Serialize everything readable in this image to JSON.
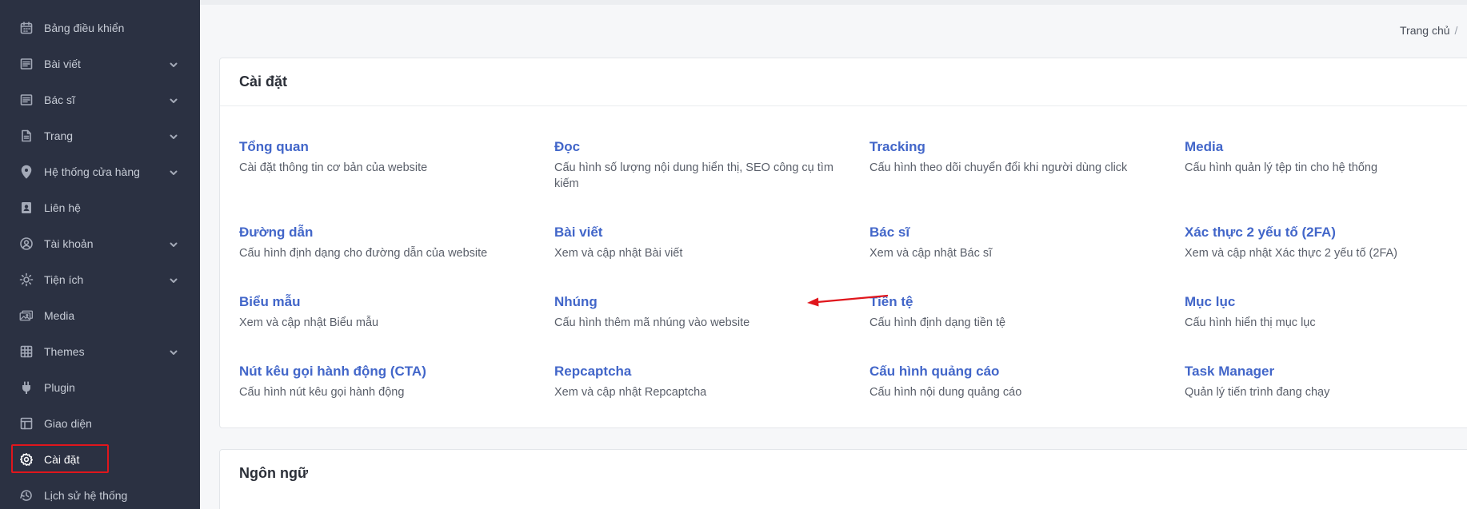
{
  "sidebar": {
    "items": [
      {
        "label": "Bảng điều khiển",
        "icon": "calendar-icon",
        "has_chevron": false
      },
      {
        "label": "Bài viết",
        "icon": "article-icon",
        "has_chevron": true
      },
      {
        "label": "Bác sĩ",
        "icon": "article-icon",
        "has_chevron": true
      },
      {
        "label": "Trang",
        "icon": "page-icon",
        "has_chevron": true
      },
      {
        "label": "Hệ thống cửa hàng",
        "icon": "map-pin-icon",
        "has_chevron": true
      },
      {
        "label": "Liên hệ",
        "icon": "contact-icon",
        "has_chevron": false
      },
      {
        "label": "Tài khoản",
        "icon": "user-circle-icon",
        "has_chevron": true
      },
      {
        "label": "Tiện ích",
        "icon": "sun-icon",
        "has_chevron": true
      },
      {
        "label": "Media",
        "icon": "photos-icon",
        "has_chevron": false
      },
      {
        "label": "Themes",
        "icon": "grid-icon",
        "has_chevron": true
      },
      {
        "label": "Plugin",
        "icon": "plug-icon",
        "has_chevron": false
      },
      {
        "label": "Giao diện",
        "icon": "layout-icon",
        "has_chevron": false
      },
      {
        "label": "Cài đặt",
        "icon": "gear-icon",
        "has_chevron": false,
        "active": true
      },
      {
        "label": "Lịch sử hệ thống",
        "icon": "history-icon",
        "has_chevron": false
      }
    ]
  },
  "breadcrumb": {
    "home": "Trang chủ",
    "separator": "/"
  },
  "settings_card": {
    "title": "Cài đặt",
    "items": [
      {
        "title": "Tổng quan",
        "desc": "Cài đặt thông tin cơ bản của website"
      },
      {
        "title": "Đọc",
        "desc": "Cấu hình số lượng nội dung hiển thị, SEO công cụ tìm kiếm"
      },
      {
        "title": "Tracking",
        "desc": "Cấu hình theo dõi chuyển đổi khi người dùng click"
      },
      {
        "title": "Media",
        "desc": "Cấu hình quản lý tệp tin cho hệ thống"
      },
      {
        "title": "Đường dẫn",
        "desc": "Cấu hình định dạng cho đường dẫn của website"
      },
      {
        "title": "Bài viết",
        "desc": "Xem và cập nhật Bài viết"
      },
      {
        "title": "Bác sĩ",
        "desc": "Xem và cập nhật Bác sĩ"
      },
      {
        "title": "Xác thực 2 yếu tố (2FA)",
        "desc": "Xem và cập nhật Xác thực 2 yếu tố (2FA)"
      },
      {
        "title": "Biểu mẫu",
        "desc": "Xem và cập nhật Biểu mẫu"
      },
      {
        "title": "Nhúng",
        "desc": "Cấu hình thêm mã nhúng vào website"
      },
      {
        "title": "Tiền tệ",
        "desc": "Cấu hình định dạng tiền tệ"
      },
      {
        "title": "Mục lục",
        "desc": "Cấu hình hiển thị mục lục"
      },
      {
        "title": "Nút kêu gọi hành động (CTA)",
        "desc": "Cấu hình nút kêu gọi hành động"
      },
      {
        "title": "Repcaptcha",
        "desc": "Xem và cập nhật Repcaptcha"
      },
      {
        "title": "Cấu hình quảng cáo",
        "desc": "Cấu hình nội dung quảng cáo"
      },
      {
        "title": "Task Manager",
        "desc": "Quản lý tiến trình đang chạy"
      }
    ]
  },
  "language_card": {
    "title": "Ngôn ngữ"
  },
  "colors": {
    "sidebar_bg": "#2b3142",
    "link": "#4266c9",
    "highlight": "#e0161c"
  }
}
